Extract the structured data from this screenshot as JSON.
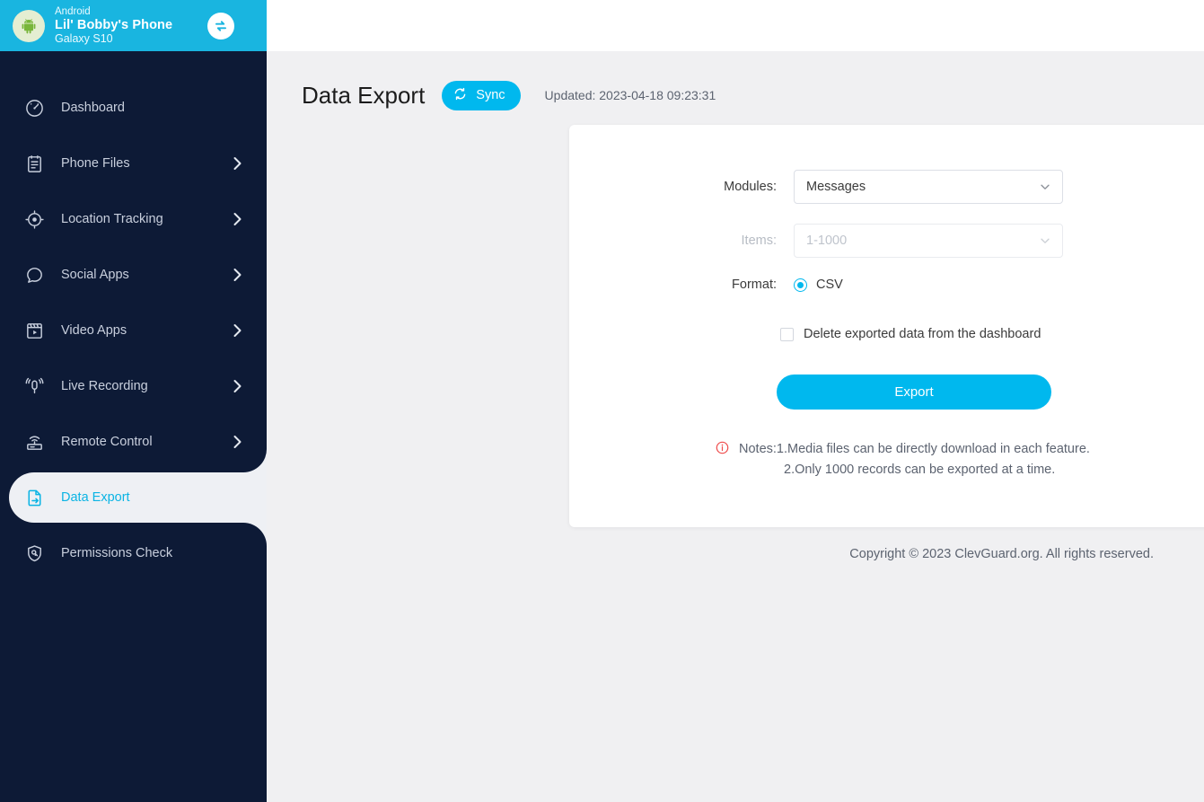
{
  "device": {
    "os_label": "Android",
    "name": "Lil' Bobby's Phone",
    "model": "Galaxy S10",
    "android_icon": "android-robot-icon",
    "switch_icon": "switch-device-icon"
  },
  "sidebar": {
    "items": [
      {
        "label": "Dashboard",
        "icon": "dashboard-gauge-icon",
        "has_chevron": false,
        "active": false
      },
      {
        "label": "Phone Files",
        "icon": "clipboard-icon",
        "has_chevron": true,
        "active": false
      },
      {
        "label": "Location Tracking",
        "icon": "target-location-icon",
        "has_chevron": true,
        "active": false
      },
      {
        "label": "Social Apps",
        "icon": "chat-bubble-icon",
        "has_chevron": true,
        "active": false
      },
      {
        "label": "Video Apps",
        "icon": "clapperboard-play-icon",
        "has_chevron": true,
        "active": false
      },
      {
        "label": "Live Recording",
        "icon": "microphone-waves-icon",
        "has_chevron": true,
        "active": false
      },
      {
        "label": "Remote Control",
        "icon": "router-signal-icon",
        "has_chevron": true,
        "active": false
      },
      {
        "label": "Data Export",
        "icon": "file-export-icon",
        "has_chevron": false,
        "active": true
      },
      {
        "label": "Permissions Check",
        "icon": "shield-key-icon",
        "has_chevron": false,
        "active": false
      }
    ]
  },
  "page": {
    "title": "Data Export",
    "sync_label": "Sync",
    "sync_icon": "refresh-icon",
    "updated_text": "Updated: 2023-04-18 09:23:31"
  },
  "form": {
    "modules_label": "Modules:",
    "modules_value": "Messages",
    "items_label": "Items:",
    "items_value": "1-1000",
    "items_disabled": true,
    "format_label": "Format:",
    "format_option": "CSV",
    "format_selected": true,
    "delete_checkbox_label": "Delete exported data from the dashboard",
    "delete_checked": false,
    "export_label": "Export",
    "chevron_icon": "chevron-down-icon"
  },
  "notes": {
    "icon": "info-circle-icon",
    "line1": "Notes:1.Media files can be directly download in each feature.",
    "line2": "2.Only 1000 records can be exported at a time."
  },
  "footer": {
    "copyright": "Copyright © 2023 ClevGuard.org. All rights reserved."
  },
  "colors": {
    "header_cyan": "#19b5e0",
    "sidebar_navy": "#0d1a36",
    "accent_cyan": "#00b8ee",
    "page_bg": "#f0f0f2",
    "notes_red": "#ef4d4d"
  }
}
